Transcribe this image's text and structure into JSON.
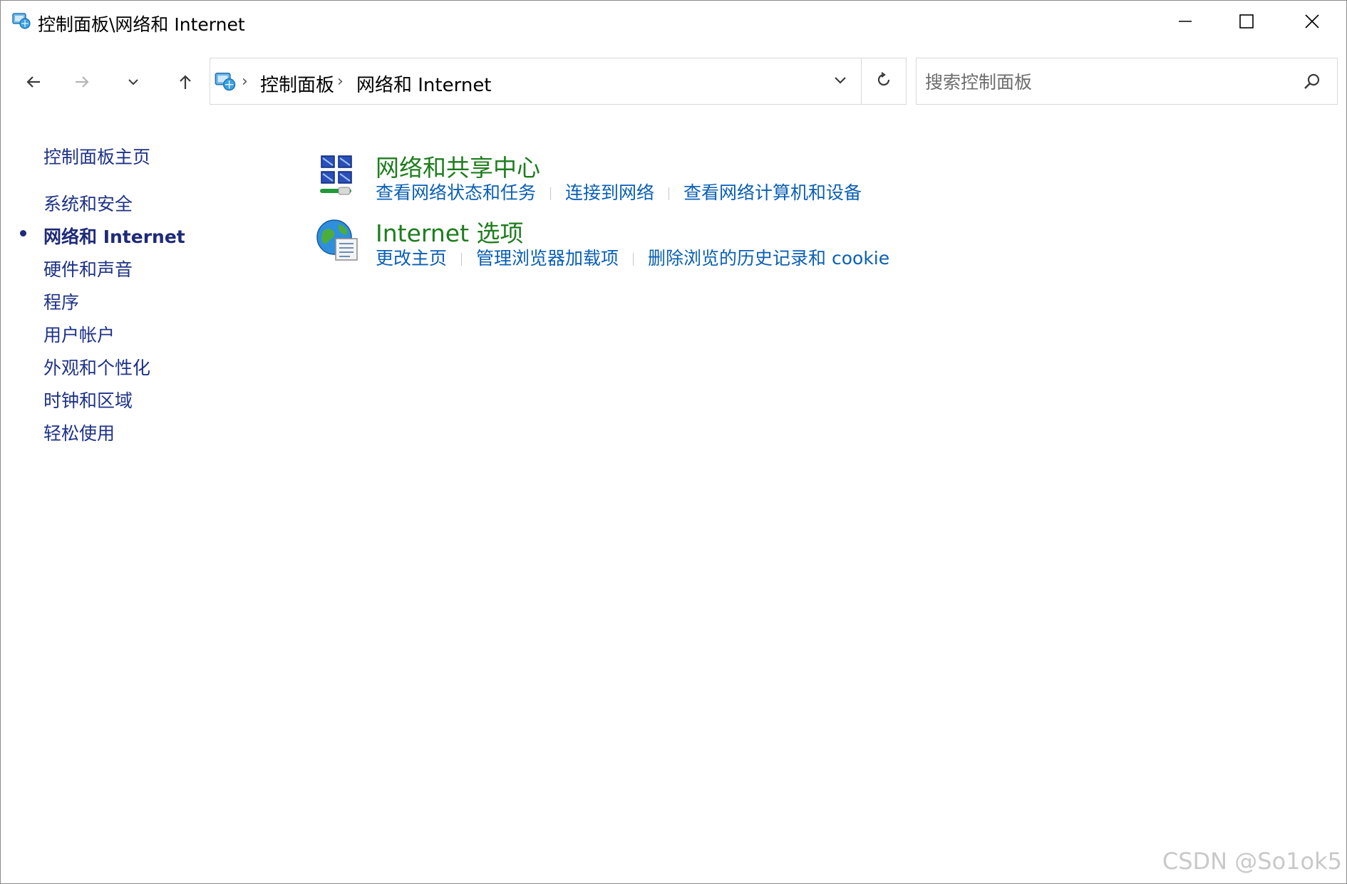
{
  "window": {
    "title": "控制面板\\网络和 Internet"
  },
  "titlebar_buttons": {
    "minimize": "minimize-icon",
    "maximize": "maximize-icon",
    "close": "close-icon"
  },
  "nav": {
    "back": "arrow-left-icon",
    "forward": "arrow-right-icon",
    "recent": "chevron-down-icon",
    "up": "arrow-up-icon"
  },
  "address": {
    "crumbs": [
      "控制面板",
      "网络和 Internet"
    ],
    "refresh": "refresh-icon"
  },
  "search": {
    "placeholder": "搜索控制面板",
    "value": ""
  },
  "sidebar": {
    "items": [
      {
        "label": "控制面板主页",
        "current": false
      },
      {
        "label": "系统和安全",
        "current": false
      },
      {
        "label": "网络和 Internet",
        "current": true
      },
      {
        "label": "硬件和声音",
        "current": false
      },
      {
        "label": "程序",
        "current": false
      },
      {
        "label": "用户帐户",
        "current": false
      },
      {
        "label": "外观和个性化",
        "current": false
      },
      {
        "label": "时钟和区域",
        "current": false
      },
      {
        "label": "轻松使用",
        "current": false
      }
    ]
  },
  "categories": [
    {
      "title": "网络和共享中心",
      "icon": "network-sharing-center-icon",
      "links": [
        "查看网络状态和任务",
        "连接到网络",
        "查看网络计算机和设备"
      ]
    },
    {
      "title": "Internet 选项",
      "icon": "internet-options-globe-icon",
      "links": [
        "更改主页",
        "管理浏览器加载项",
        "删除浏览的历史记录和 cookie"
      ]
    }
  ],
  "colors": {
    "category_title": "#1e7d1e",
    "link": "#0a5fb4",
    "sidebar_link": "#1e3287"
  },
  "watermark": "CSDN @So1ok5"
}
